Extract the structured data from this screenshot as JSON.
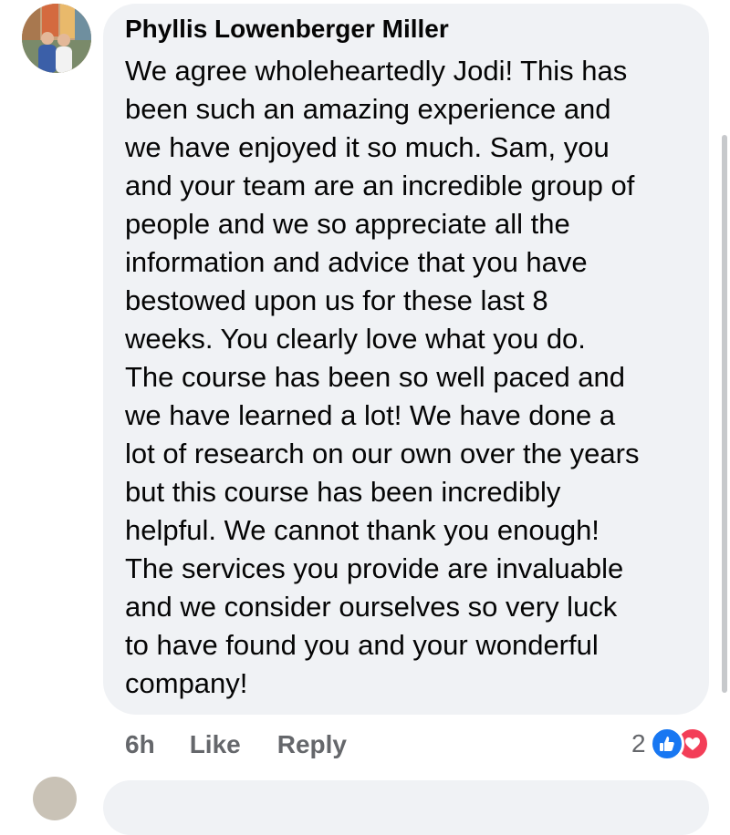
{
  "comment": {
    "author": "Phyllis Lowenberger Miller",
    "lines": [
      "We agree wholeheartedly Jodi!  This has",
      "been such an amazing experience and",
      "we have enjoyed it so much.  Sam, you",
      "and your team are an incredible group of",
      "people and we so appreciate all the",
      "information and advice that you have",
      "bestowed upon us for these last 8",
      "weeks.  You clearly love what you do.",
      "The course has been so well paced and",
      "we have learned a lot!  We have done a",
      "lot of research on our own over the years",
      "but this course has been incredibly",
      "helpful.  We cannot thank you enough!",
      "The services you provide are invaluable",
      "and we consider ourselves so very luck",
      "to have found you and your wonderful",
      "company!"
    ]
  },
  "actions": {
    "time": "6h",
    "like_label": "Like",
    "reply_label": "Reply"
  },
  "reactions": {
    "count": "2",
    "icons": [
      "like-icon",
      "love-icon"
    ]
  },
  "colors": {
    "bubble": "#f0f2f5",
    "like_blue": "#1877f2",
    "love_red": "#f33e58",
    "meta_gray": "#65676b"
  }
}
